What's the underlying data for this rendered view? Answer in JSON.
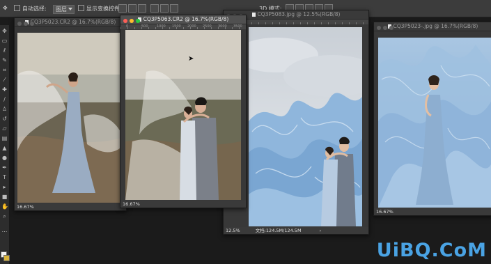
{
  "options_bar": {
    "auto_select_label": "自动选择:",
    "auto_select_value": "图层",
    "show_transform_label": "显示变换控件",
    "mode_3d_label": "3D 模式:"
  },
  "tools": [
    "move",
    "marquee",
    "lasso",
    "quick-select",
    "crop",
    "eyedropper",
    "healing",
    "brush",
    "stamp",
    "history",
    "eraser",
    "gradient",
    "blur",
    "dodge",
    "pen",
    "type",
    "path-select",
    "shape",
    "hand",
    "zoom",
    "more"
  ],
  "colors": {
    "foreground": "#f2f2f2",
    "background": "#d9b43c"
  },
  "windows": [
    {
      "id": "win1",
      "title": "CQ3P5023.CR2 @ 16.7%(RGB/8)",
      "status": "16.67%",
      "active": false
    },
    {
      "id": "win2",
      "title": "CQ3P5063.CR2 @ 16.7%(RGB/8)",
      "status": "16.67%",
      "active": true,
      "ruler_marks": [
        "0",
        "500",
        "1000",
        "1500",
        "2000",
        "2500",
        "3000",
        "3500"
      ]
    },
    {
      "id": "win3",
      "title": "CQ3P5083.jpg @ 12.5%(RGB/8)",
      "status_zoom": "12.5%",
      "status_doc": "文档:124.5M/124.5M",
      "active": false
    },
    {
      "id": "win4",
      "title": "CQ3P5023-.jpg @ 16.7%(RGB/8)",
      "status": "16.67%",
      "active": false
    }
  ],
  "watermark": "UiBQ.CoM"
}
